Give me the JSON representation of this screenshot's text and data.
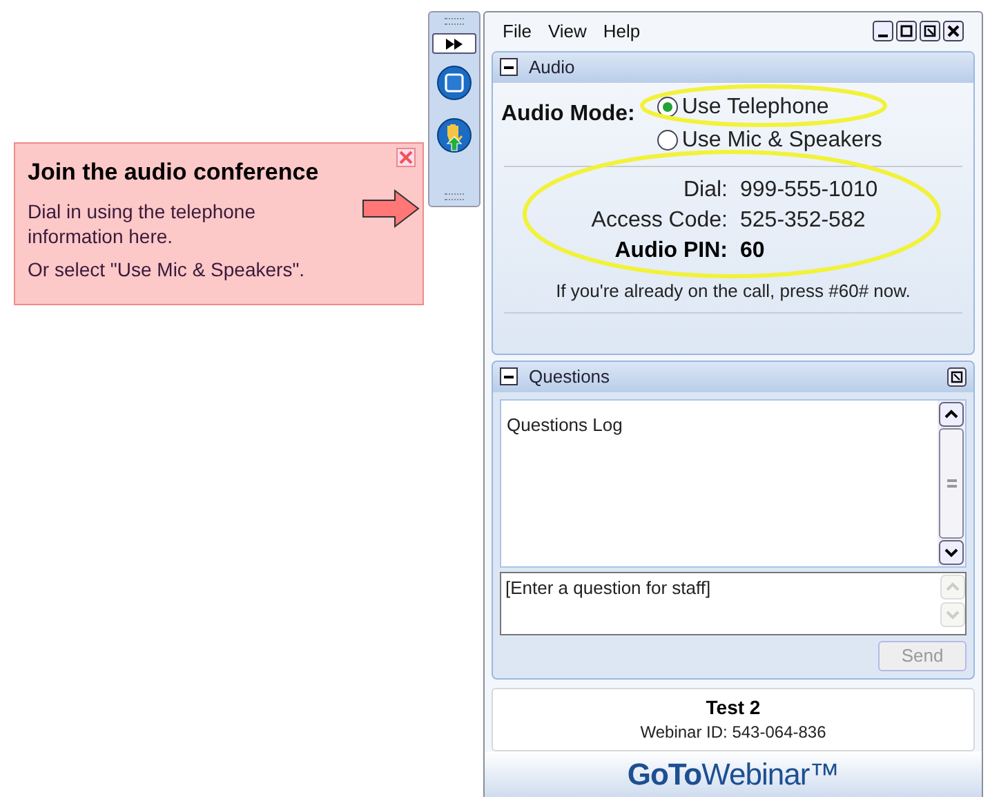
{
  "callout": {
    "title": "Join the audio conference",
    "lines": [
      "Dial in using the telephone information here.",
      "Or select \"Use Mic & Speakers\"."
    ]
  },
  "menu": [
    "File",
    "View",
    "Help"
  ],
  "audio": {
    "header": "Audio",
    "mode_label": "Audio Mode:",
    "options": [
      {
        "label": "Use Telephone",
        "selected": true
      },
      {
        "label": "Use Mic & Speakers",
        "selected": false
      }
    ],
    "details": [
      {
        "label": "Dial:",
        "value": "999-555-1010",
        "bold": false
      },
      {
        "label": "Access Code:",
        "value": "525-352-582",
        "bold": false
      },
      {
        "label": "Audio PIN:",
        "value": "60",
        "bold": true
      }
    ],
    "note": "If you're already on the call, press #60# now."
  },
  "questions": {
    "header": "Questions",
    "log": "Questions Log",
    "placeholder": "[Enter a question for staff]",
    "send": {
      "label": "Send",
      "disabled": true
    }
  },
  "webinar": {
    "title": "Test 2",
    "id": "Webinar ID: 543-064-836"
  },
  "logo": "**GoTo**Webinar™"
}
